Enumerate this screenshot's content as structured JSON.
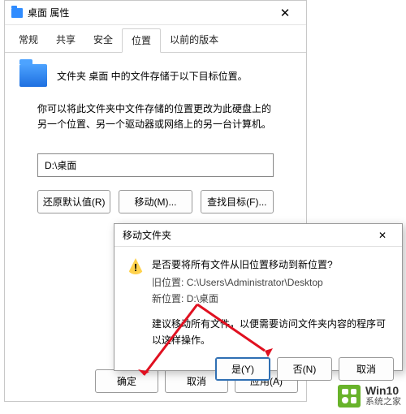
{
  "propWindow": {
    "title": "桌面 属性",
    "tabs": [
      "常规",
      "共享",
      "安全",
      "位置",
      "以前的版本"
    ],
    "activeTabIndex": 3,
    "infoLine": "文件夹 桌面 中的文件存储于以下目标位置。",
    "description": "你可以将此文件夹中文件存储的位置更改为此硬盘上的另一个位置、另一个驱动器或网络上的另一台计算机。",
    "pathValue": "D:\\桌面",
    "buttons": {
      "restore": "还原默认值(R)",
      "move": "移动(M)...",
      "find": "查找目标(F)...",
      "ok": "确定",
      "cancel": "取消",
      "apply": "应用(A)"
    }
  },
  "dialog": {
    "title": "移动文件夹",
    "question": "是否要将所有文件从旧位置移动到新位置?",
    "oldPathLabel": "旧位置:",
    "oldPathValue": "C:\\Users\\Administrator\\Desktop",
    "newPathLabel": "新位置:",
    "newPathValue": "D:\\桌面",
    "advice": "建议移动所有文件，以便需要访问文件夹内容的程序可以这样操作。",
    "buttons": {
      "yes": "是(Y)",
      "no": "否(N)",
      "cancel": "取消"
    }
  },
  "watermark": {
    "line1": "Win10",
    "line2": "系统之家"
  }
}
